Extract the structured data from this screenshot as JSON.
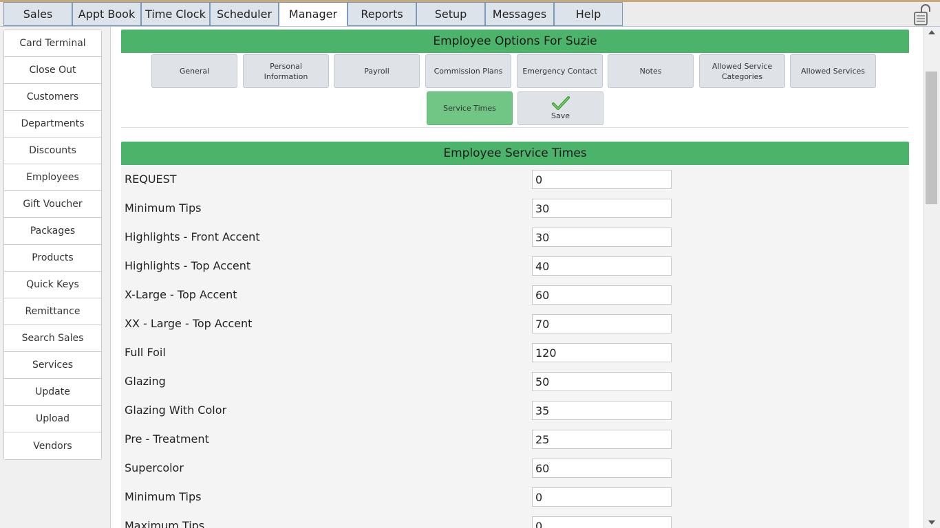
{
  "nav": {
    "tabs": [
      {
        "label": "Sales"
      },
      {
        "label": "Appt Book"
      },
      {
        "label": "Time Clock"
      },
      {
        "label": "Scheduler"
      },
      {
        "label": "Manager",
        "active": true
      },
      {
        "label": "Reports"
      },
      {
        "label": "Setup"
      },
      {
        "label": "Messages"
      },
      {
        "label": "Help"
      }
    ],
    "lock_icon": "lock-icon"
  },
  "sidebar": {
    "items": [
      {
        "label": "Card Terminal"
      },
      {
        "label": "Close Out"
      },
      {
        "label": "Customers"
      },
      {
        "label": "Departments"
      },
      {
        "label": "Discounts"
      },
      {
        "label": "Employees"
      },
      {
        "label": "Gift Voucher"
      },
      {
        "label": "Packages"
      },
      {
        "label": "Products"
      },
      {
        "label": "Quick Keys"
      },
      {
        "label": "Remittance"
      },
      {
        "label": "Search Sales"
      },
      {
        "label": "Services"
      },
      {
        "label": "Update"
      },
      {
        "label": "Upload"
      },
      {
        "label": "Vendors"
      }
    ]
  },
  "options": {
    "title": "Employee Options For Suzie",
    "buttons": [
      {
        "label": "General"
      },
      {
        "label": "Personal Information"
      },
      {
        "label": "Payroll"
      },
      {
        "label": "Commission Plans"
      },
      {
        "label": "Emergency Contact"
      },
      {
        "label": "Notes"
      },
      {
        "label": "Allowed Service Categories"
      },
      {
        "label": "Allowed Services"
      },
      {
        "label": "Service Times",
        "active": true
      }
    ],
    "save_label": "Save",
    "save_icon": "checkmark-icon"
  },
  "service_times": {
    "title": "Employee Service Times",
    "rows": [
      {
        "label": "REQUEST",
        "value": "0"
      },
      {
        "label": "Minimum Tips",
        "value": "30"
      },
      {
        "label": "Highlights - Front Accent",
        "value": "30"
      },
      {
        "label": "Highlights - Top Accent",
        "value": "40"
      },
      {
        "label": "X-Large - Top Accent",
        "value": "60"
      },
      {
        "label": "XX - Large - Top Accent",
        "value": "70"
      },
      {
        "label": "Full Foil",
        "value": "120"
      },
      {
        "label": "Glazing",
        "value": "50"
      },
      {
        "label": "Glazing With Color",
        "value": "35"
      },
      {
        "label": "Pre - Treatment",
        "value": "25"
      },
      {
        "label": "Supercolor",
        "value": "60"
      },
      {
        "label": "Minimum Tips",
        "value": "0"
      },
      {
        "label": "Maximum Tips",
        "value": "0"
      }
    ]
  },
  "colors": {
    "header_green": "#4cb46a",
    "active_button_green": "#71c585",
    "tab_border": "#7a99bb"
  }
}
